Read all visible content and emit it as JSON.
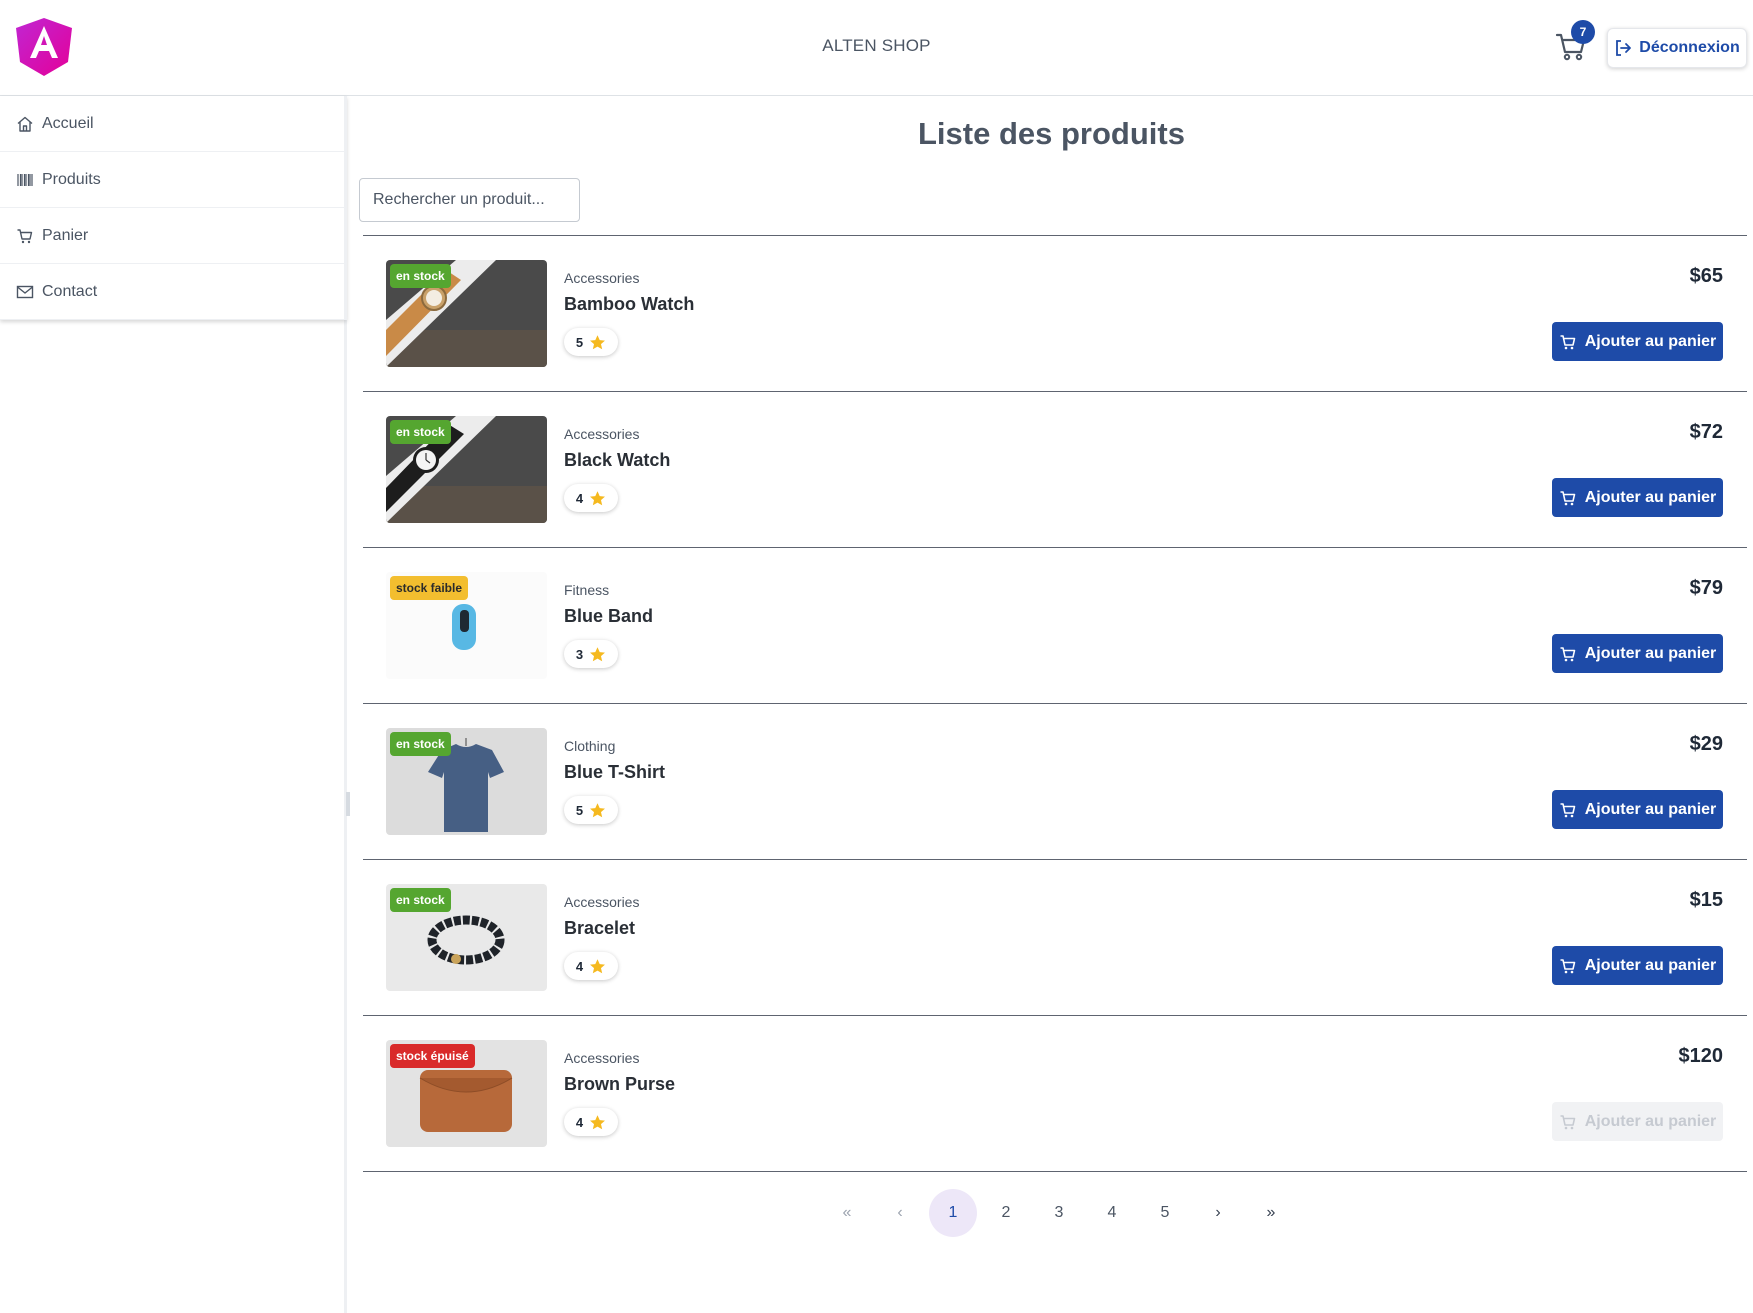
{
  "header": {
    "app_title": "ALTEN SHOP",
    "cart_count": "7",
    "logout_label": "Déconnexion",
    "brand_colors": {
      "primary": "#1e4ba8",
      "logo_pink": "#e40098",
      "logo_magenta": "#c026d3"
    }
  },
  "sidebar": {
    "items": [
      {
        "label": "Accueil",
        "icon": "home-icon"
      },
      {
        "label": "Produits",
        "icon": "barcode-icon"
      },
      {
        "label": "Panier",
        "icon": "cart-icon"
      },
      {
        "label": "Contact",
        "icon": "envelope-icon"
      }
    ]
  },
  "main": {
    "title": "Liste des produits",
    "search_placeholder": "Rechercher un produit...",
    "add_label": "Ajouter au panier",
    "products": [
      {
        "category": "Accessories",
        "name": "Bamboo Watch",
        "rating": "5",
        "price": "$65",
        "stock": "en stock",
        "stock_status": "green"
      },
      {
        "category": "Accessories",
        "name": "Black Watch",
        "rating": "4",
        "price": "$72",
        "stock": "en stock",
        "stock_status": "green"
      },
      {
        "category": "Fitness",
        "name": "Blue Band",
        "rating": "3",
        "price": "$79",
        "stock": "stock faible",
        "stock_status": "yellow"
      },
      {
        "category": "Clothing",
        "name": "Blue T-Shirt",
        "rating": "5",
        "price": "$29",
        "stock": "en stock",
        "stock_status": "green"
      },
      {
        "category": "Accessories",
        "name": "Bracelet",
        "rating": "4",
        "price": "$15",
        "stock": "en stock",
        "stock_status": "green"
      },
      {
        "category": "Accessories",
        "name": "Brown Purse",
        "rating": "4",
        "price": "$120",
        "stock": "stock épuisé",
        "stock_status": "red"
      }
    ]
  },
  "pagination": {
    "first": "«",
    "prev": "‹",
    "pages": [
      "1",
      "2",
      "3",
      "4",
      "5"
    ],
    "current": "1",
    "next": "›",
    "last": "»"
  }
}
